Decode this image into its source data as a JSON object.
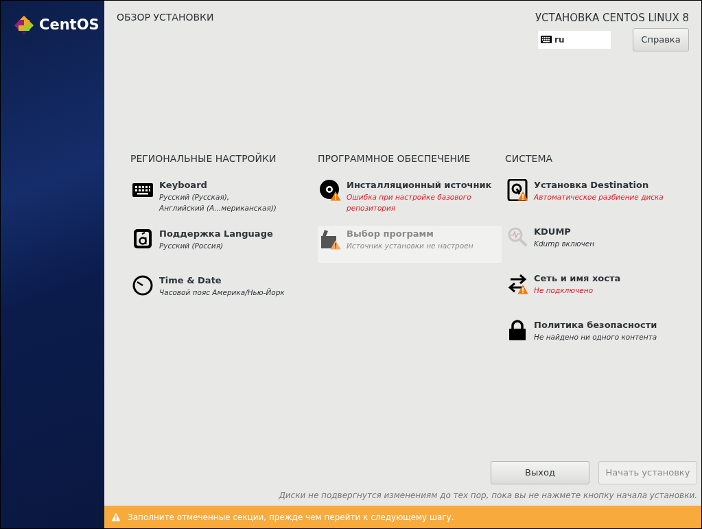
{
  "sidebar": {
    "logo_text": "CentOS"
  },
  "header": {
    "title": "ОБЗОР УСТАНОВКИ",
    "product": "УСТАНОВКА CENTOS LINUX 8",
    "keyboard_layout": "ru",
    "help_button": "Справка"
  },
  "sections": [
    {
      "title": "РЕГИОНАЛЬНЫЕ НАСТРОЙКИ",
      "items": [
        {
          "kind": "keyboard",
          "title": "Keyboard",
          "status": [
            "Русский (Русская),",
            "Английский (А...мериканская))"
          ],
          "error": false,
          "warning": false,
          "disabled": false
        },
        {
          "kind": "language",
          "title": "Поддержка Language",
          "status": [
            "Русский (Россия)"
          ],
          "error": false,
          "warning": false,
          "disabled": false
        },
        {
          "kind": "clock",
          "title": "Time & Date",
          "status": [
            "Часовой пояс Америка/Нью-Йорк"
          ],
          "error": false,
          "warning": false,
          "disabled": false
        }
      ]
    },
    {
      "title": "ПРОГРАММНОЕ ОБЕСПЕЧЕНИЕ",
      "items": [
        {
          "kind": "disc",
          "title": "Инсталляционный источник",
          "status": [
            "Ошибка при настройке базового",
            "репозитория"
          ],
          "error": true,
          "warning": true,
          "disabled": false
        },
        {
          "kind": "package",
          "title": "Выбор программ",
          "status": [
            "Источник установки не настроен"
          ],
          "error": false,
          "warning": true,
          "disabled": true
        }
      ]
    },
    {
      "title": "СИСТЕМА",
      "items": [
        {
          "kind": "disk",
          "title": "Установка Destination",
          "status": [
            "Автоматическое разбиение диска"
          ],
          "error": true,
          "warning": true,
          "disabled": false
        },
        {
          "kind": "magnifier",
          "title": "KDUMP",
          "status": [
            "Kdump включен"
          ],
          "error": false,
          "warning": false,
          "disabled": false
        },
        {
          "kind": "arrows",
          "title": "Сеть и имя хоста",
          "status": [
            "Не подключено"
          ],
          "error": true,
          "warning": true,
          "disabled": false
        },
        {
          "kind": "lock",
          "title": "Политика безопасности",
          "status": [
            "Не найдено ни одного контента"
          ],
          "error": false,
          "warning": false,
          "disabled": false
        }
      ]
    }
  ],
  "footer": {
    "buttons": [
      {
        "label": "Выход",
        "disabled": false
      },
      {
        "label": "Начать установку",
        "disabled": true
      }
    ],
    "note": "Диски не подвергнутся изменениям до тех пор, пока вы не нажмете кнопку начала установки."
  },
  "warning_bar": {
    "text": "Заполните отмеченные секции, прежде чем перейти к следующему шагу."
  }
}
